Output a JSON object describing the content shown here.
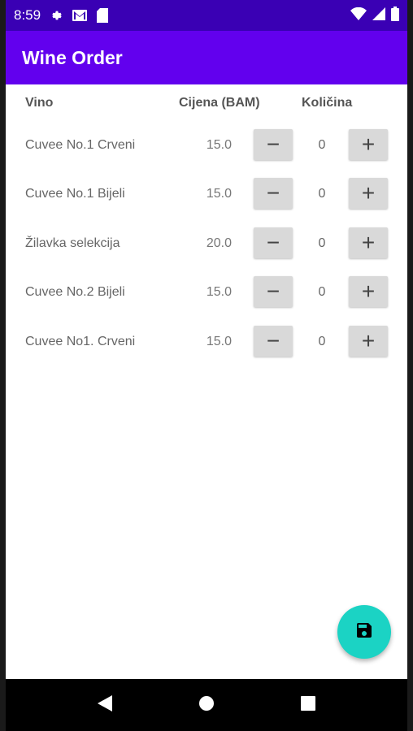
{
  "status_bar": {
    "time": "8:59",
    "bg_color": "#3a00b4"
  },
  "app_bar": {
    "title": "Wine Order",
    "bg_color": "#6200ee"
  },
  "table": {
    "headers": {
      "name": "Vino",
      "price": "Cijena (BAM)",
      "quantity": "Količina"
    },
    "rows": [
      {
        "name": "Cuvee No.1 Crveni",
        "price": "15.0",
        "qty": "0"
      },
      {
        "name": "Cuvee No.1 Bijeli",
        "price": "15.0",
        "qty": "0"
      },
      {
        "name": "Žilavka selekcija",
        "price": "20.0",
        "qty": "0"
      },
      {
        "name": "Cuvee No.2 Bijeli",
        "price": "15.0",
        "qty": "0"
      },
      {
        "name": "Cuvee No1. Crveni",
        "price": "15.0",
        "qty": "0"
      }
    ],
    "minus_symbol": "−",
    "plus_symbol": "+"
  },
  "fab": {
    "icon": "save-icon",
    "color": "#1bd3c4"
  },
  "nav_bar": {
    "icons": [
      "back-icon",
      "home-icon",
      "recents-icon"
    ]
  }
}
